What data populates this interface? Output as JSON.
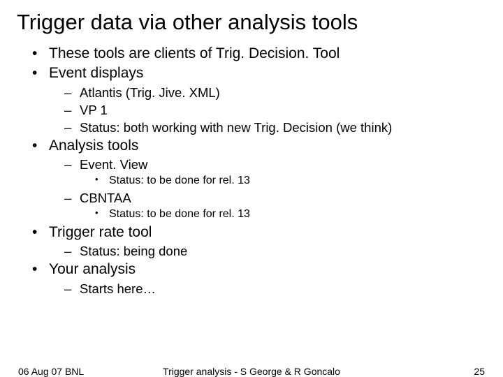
{
  "title": "Trigger data via other analysis tools",
  "b0": "These tools are clients of Trig. Decision. Tool",
  "b1": "Event displays",
  "b1_0": "Atlantis (Trig. Jive. XML)",
  "b1_1": "VP 1",
  "b1_2": "Status: both working with new Trig. Decision (we think)",
  "b2": "Analysis tools",
  "b2_0": "Event. View",
  "b2_0_0": "Status: to be done for rel. 13",
  "b2_1": "CBNTAA",
  "b2_1_0": "Status: to be done for rel. 13",
  "b3": "Trigger rate tool",
  "b3_0": "Status: being done",
  "b4": "Your analysis",
  "b4_0": "Starts here…",
  "footer_left": "06 Aug 07 BNL",
  "footer_center": "Trigger analysis - S George & R Goncalo",
  "footer_right": "25"
}
